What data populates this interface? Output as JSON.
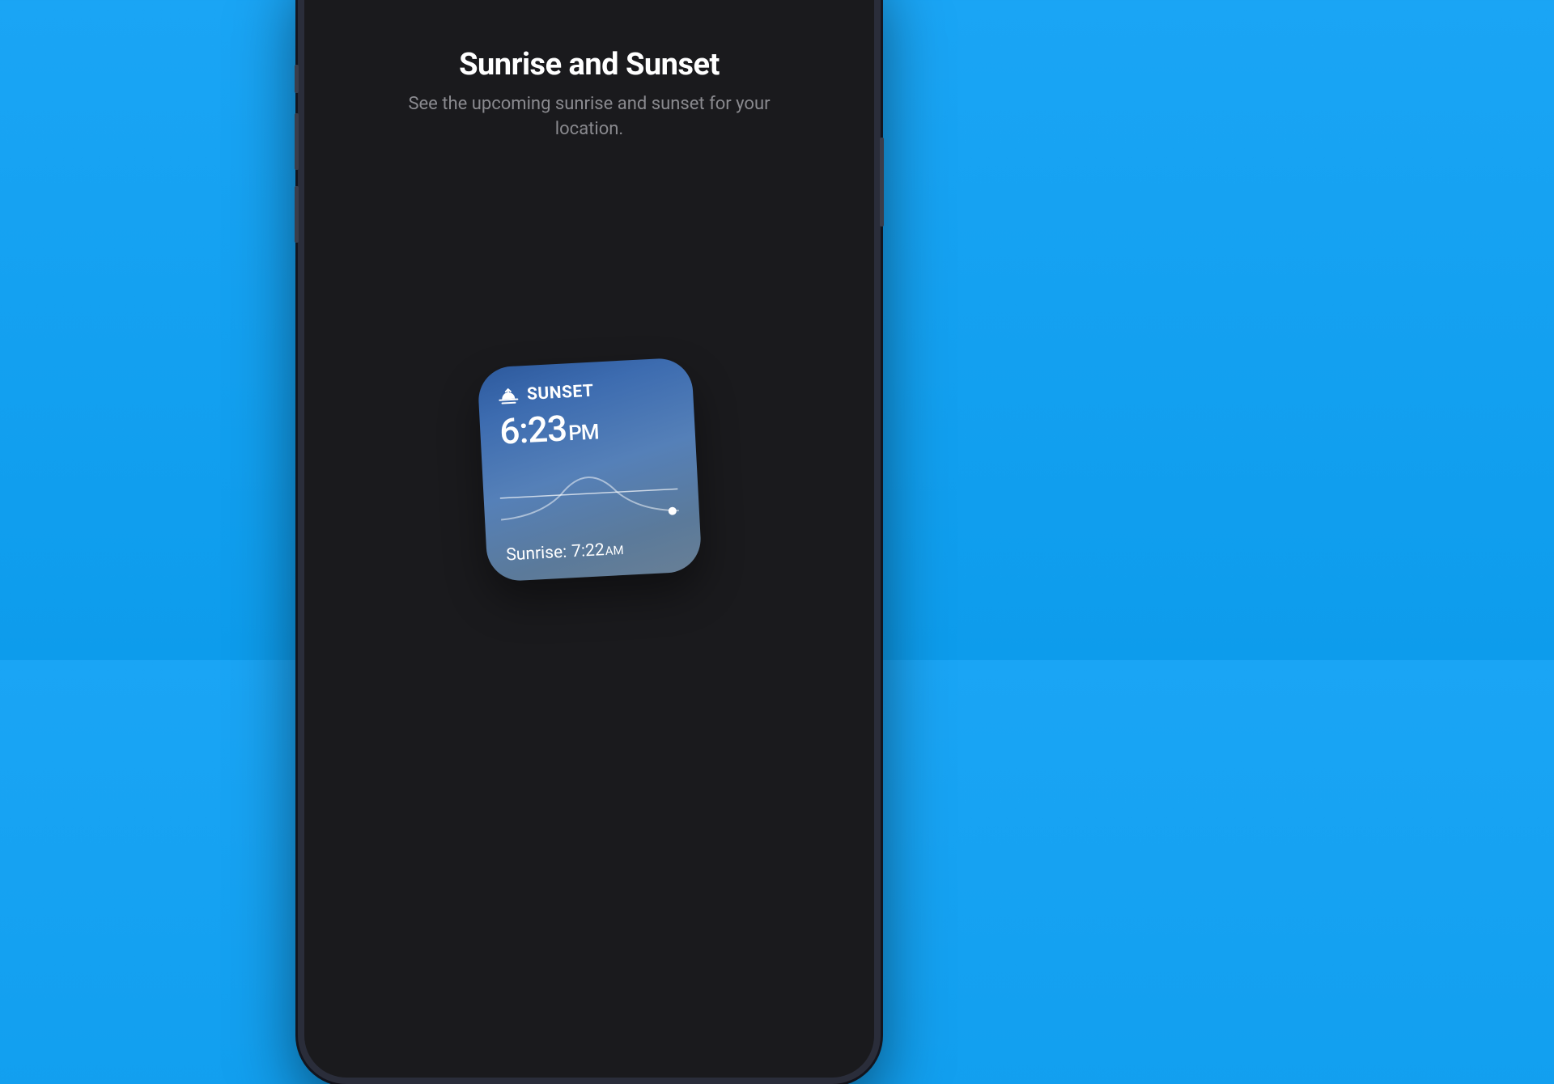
{
  "header": {
    "title": "Sunrise and Sunset",
    "subtitle": "See the upcoming sunrise and sunset for your location."
  },
  "widget": {
    "label": "SUNSET",
    "time": "6:23",
    "time_suffix": "PM",
    "sunrise_label": "Sunrise:",
    "sunrise_time": "7:22",
    "sunrise_suffix": "AM"
  }
}
